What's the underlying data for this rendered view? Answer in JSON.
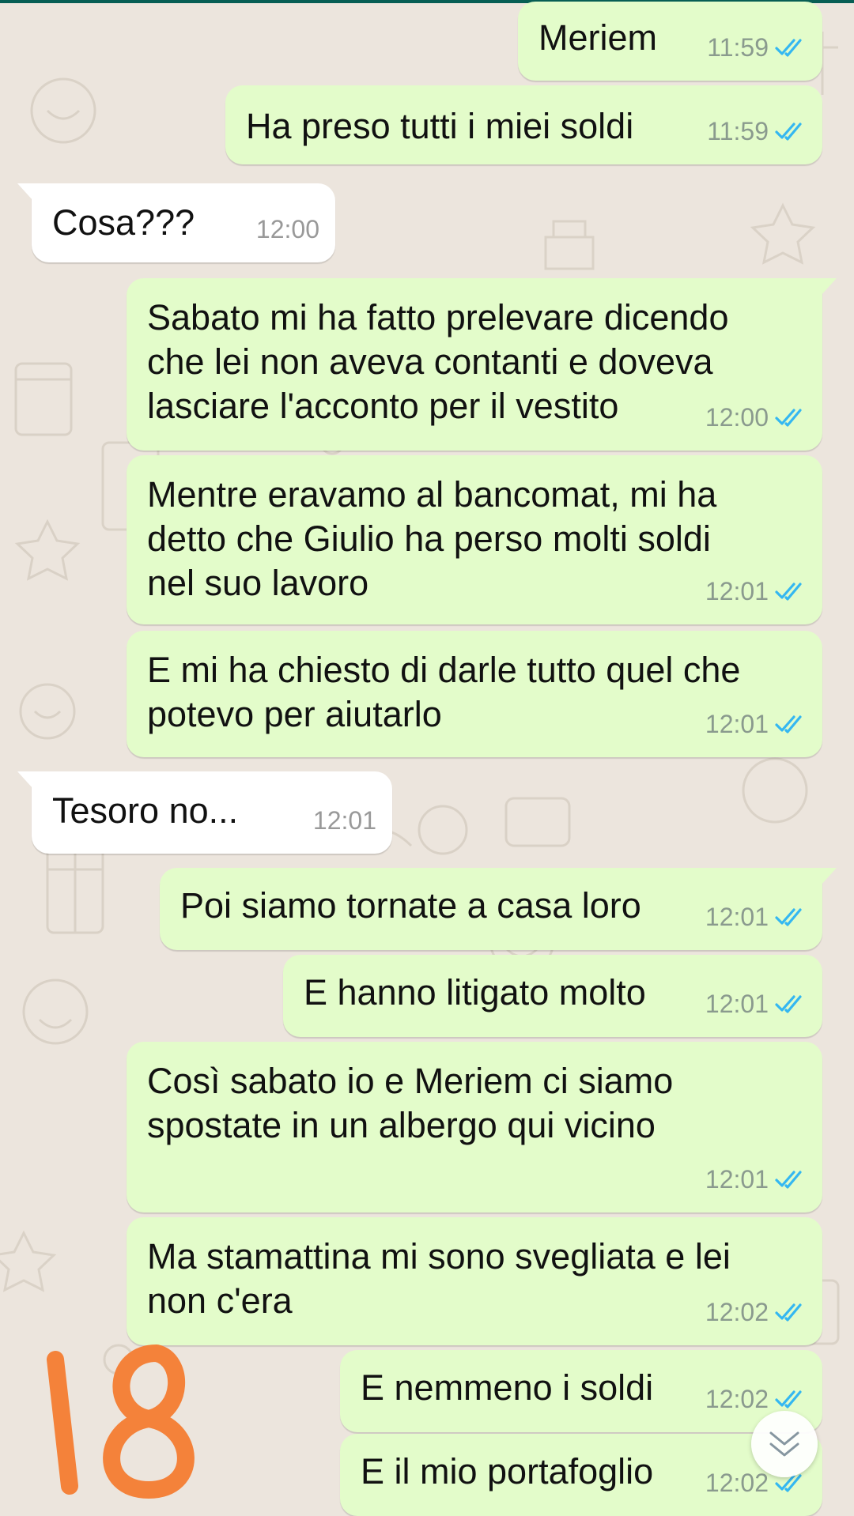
{
  "colors": {
    "outgoing_bubble": "#e3fcca",
    "incoming_bubble": "#ffffff",
    "read_tick": "#34b7f1",
    "wallpaper": "#ece5dd",
    "sticker": "#f4823a"
  },
  "messages": [
    {
      "direction": "outgoing",
      "text": "Meriem",
      "time": "11:59",
      "status": "read"
    },
    {
      "direction": "outgoing",
      "text": "Ha preso tutti i miei soldi",
      "time": "11:59",
      "status": "read"
    },
    {
      "direction": "incoming",
      "text": "Cosa???",
      "time": "12:00"
    },
    {
      "direction": "outgoing",
      "text": "Sabato mi ha fatto prelevare dicendo\nche lei non aveva contanti e doveva\nlasciare l'acconto per il vestito",
      "time": "12:00",
      "status": "read"
    },
    {
      "direction": "outgoing",
      "text": "Mentre eravamo al bancomat, mi ha\ndetto che Giulio ha perso molti soldi\nnel suo lavoro",
      "time": "12:01",
      "status": "read"
    },
    {
      "direction": "outgoing",
      "text": "E mi ha chiesto di darle tutto quel che\npotevo per aiutarlo",
      "time": "12:01",
      "status": "read"
    },
    {
      "direction": "incoming",
      "text": "Tesoro no...",
      "time": "12:01"
    },
    {
      "direction": "outgoing",
      "text": "Poi siamo tornate a casa loro",
      "time": "12:01",
      "status": "read"
    },
    {
      "direction": "outgoing",
      "text": "E hanno litigato molto",
      "time": "12:01",
      "status": "read"
    },
    {
      "direction": "outgoing",
      "text": "Così sabato io e Meriem ci siamo\nspostate in un albergo qui vicino",
      "time": "12:01",
      "status": "read"
    },
    {
      "direction": "outgoing",
      "text": "Ma stamattina mi sono svegliata e lei\nnon c'era",
      "time": "12:02",
      "status": "read"
    },
    {
      "direction": "outgoing",
      "text": "E nemmeno i soldi",
      "time": "12:02",
      "status": "read"
    },
    {
      "direction": "outgoing",
      "text": "E il mio portafoglio",
      "time": "12:02",
      "status": "read"
    }
  ],
  "sticker": {
    "text": "18",
    "icon": "handwritten-number"
  },
  "scroll_button": {
    "icon": "double-chevron-down-icon"
  }
}
